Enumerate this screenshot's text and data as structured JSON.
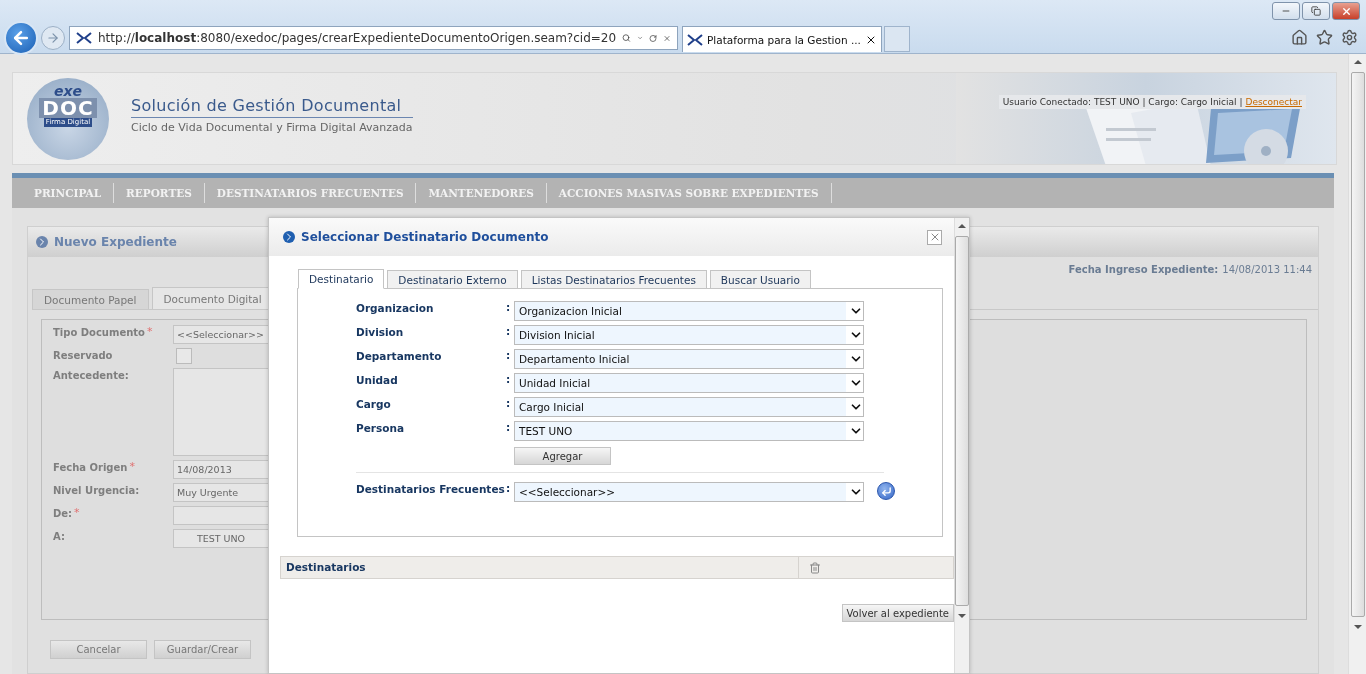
{
  "browser": {
    "url": "http://**localhost**:8080/exedoc/pages/crearExpedienteDocumentoOrigen.seam?cid=20",
    "tab_title": "Plataforma para la Gestion ..."
  },
  "header": {
    "logo_top": "exe",
    "logo_main": "DOC",
    "logo_tag": "Firma Digital",
    "title": "Solución de Gestión Documental",
    "subtitle": "Ciclo de Vida Documental y Firma Digital Avanzada",
    "user_info": "Usuario Conectado: TEST UNO | Cargo: Cargo Inicial |",
    "logout": "Desconectar"
  },
  "nav": [
    "PRINCIPAL",
    "REPORTES",
    "DESTINATARIOS FRECUENTES",
    "MANTENEDORES",
    "ACCIONES MASIVAS SOBRE EXPEDIENTES"
  ],
  "panel": {
    "title": "Nuevo Expediente",
    "date_label": "Fecha Ingreso Expediente:",
    "date_value": "14/08/2013 11:44",
    "tabs": [
      {
        "label": "Documento Papel",
        "selected": false
      },
      {
        "label": "Documento Digital",
        "selected": true
      }
    ],
    "fields": [
      {
        "kind": "select",
        "label": "Tipo Documento",
        "mark": "*",
        "value": "<<Seleccionar>>"
      },
      {
        "kind": "checkbox",
        "label": "Reservado",
        "checked": false
      },
      {
        "kind": "textarea",
        "label": "Antecedente:"
      },
      {
        "kind": "input",
        "label": "Fecha Origen",
        "mark": "*",
        "value": "14/08/2013"
      },
      {
        "kind": "select",
        "label": "Nivel Urgencia:",
        "value": "Muy Urgente"
      },
      {
        "kind": "input",
        "label": "De:",
        "mark": "*"
      },
      {
        "kind": "list",
        "label": "A:",
        "value": "TEST UNO"
      }
    ],
    "buttons": [
      "Cancelar",
      "Guardar/Crear"
    ]
  },
  "modal": {
    "title": "Seleccionar Destinatario Documento",
    "tabs": [
      {
        "label": "Destinatario",
        "selected": true
      },
      {
        "label": "Destinatario Externo",
        "selected": false
      },
      {
        "label": "Listas Destinatarios Frecuentes",
        "selected": false
      },
      {
        "label": "Buscar Usuario",
        "selected": false
      }
    ],
    "fields": [
      {
        "label": "Organizacion",
        "colon": ":",
        "value": "Organizacion Inicial"
      },
      {
        "label": "Division",
        "colon": ":",
        "value": "Division Inicial"
      },
      {
        "label": "Departamento",
        "colon": ":",
        "value": "Departamento Inicial"
      },
      {
        "label": "Unidad",
        "colon": ":",
        "value": "Unidad Inicial"
      },
      {
        "label": "Cargo",
        "colon": ":",
        "value": "Cargo Inicial"
      },
      {
        "label": "Persona",
        "colon": ":",
        "value": "TEST UNO"
      }
    ],
    "add_button": "Agregar",
    "frequent": {
      "label": "Destinatarios Frecuentes",
      "colon": ":",
      "value": "<<Seleccionar>>"
    },
    "table": {
      "column": "Destinatarios"
    },
    "back_button": "Volver al expediente"
  }
}
